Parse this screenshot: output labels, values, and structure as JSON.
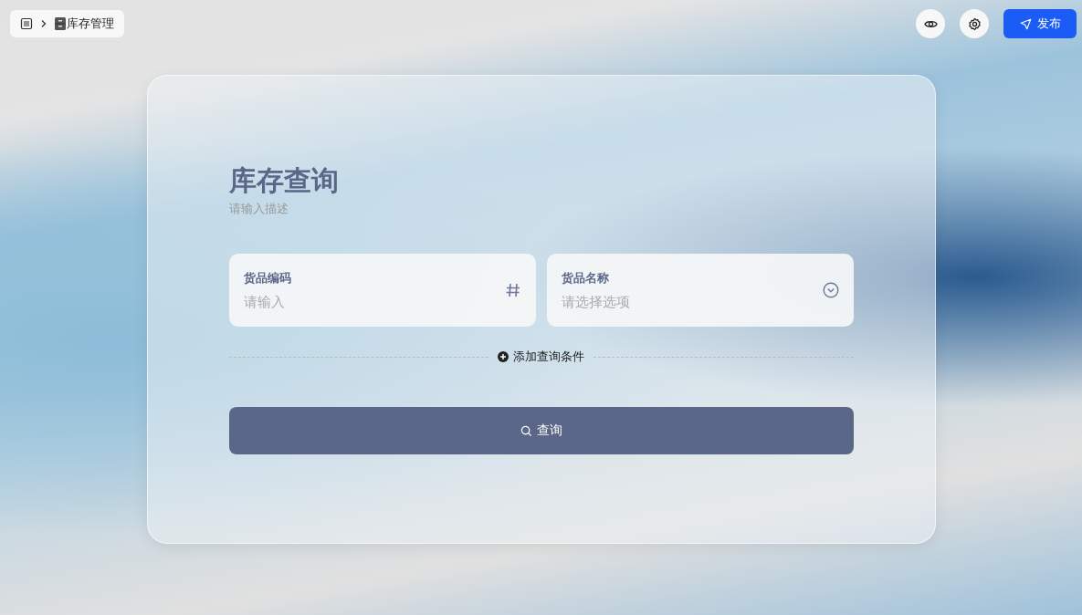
{
  "breadcrumb": {
    "current": "库存管理"
  },
  "actions": {
    "publish": "发布"
  },
  "form": {
    "title": "库存查询",
    "description": "请输入描述",
    "fields": [
      {
        "kind": "number",
        "label": "货品编码",
        "placeholder": "请输入"
      },
      {
        "kind": "select",
        "label": "货品名称",
        "placeholder": "请选择选项"
      }
    ],
    "add_condition": "添加查询条件",
    "submit": "查询"
  }
}
